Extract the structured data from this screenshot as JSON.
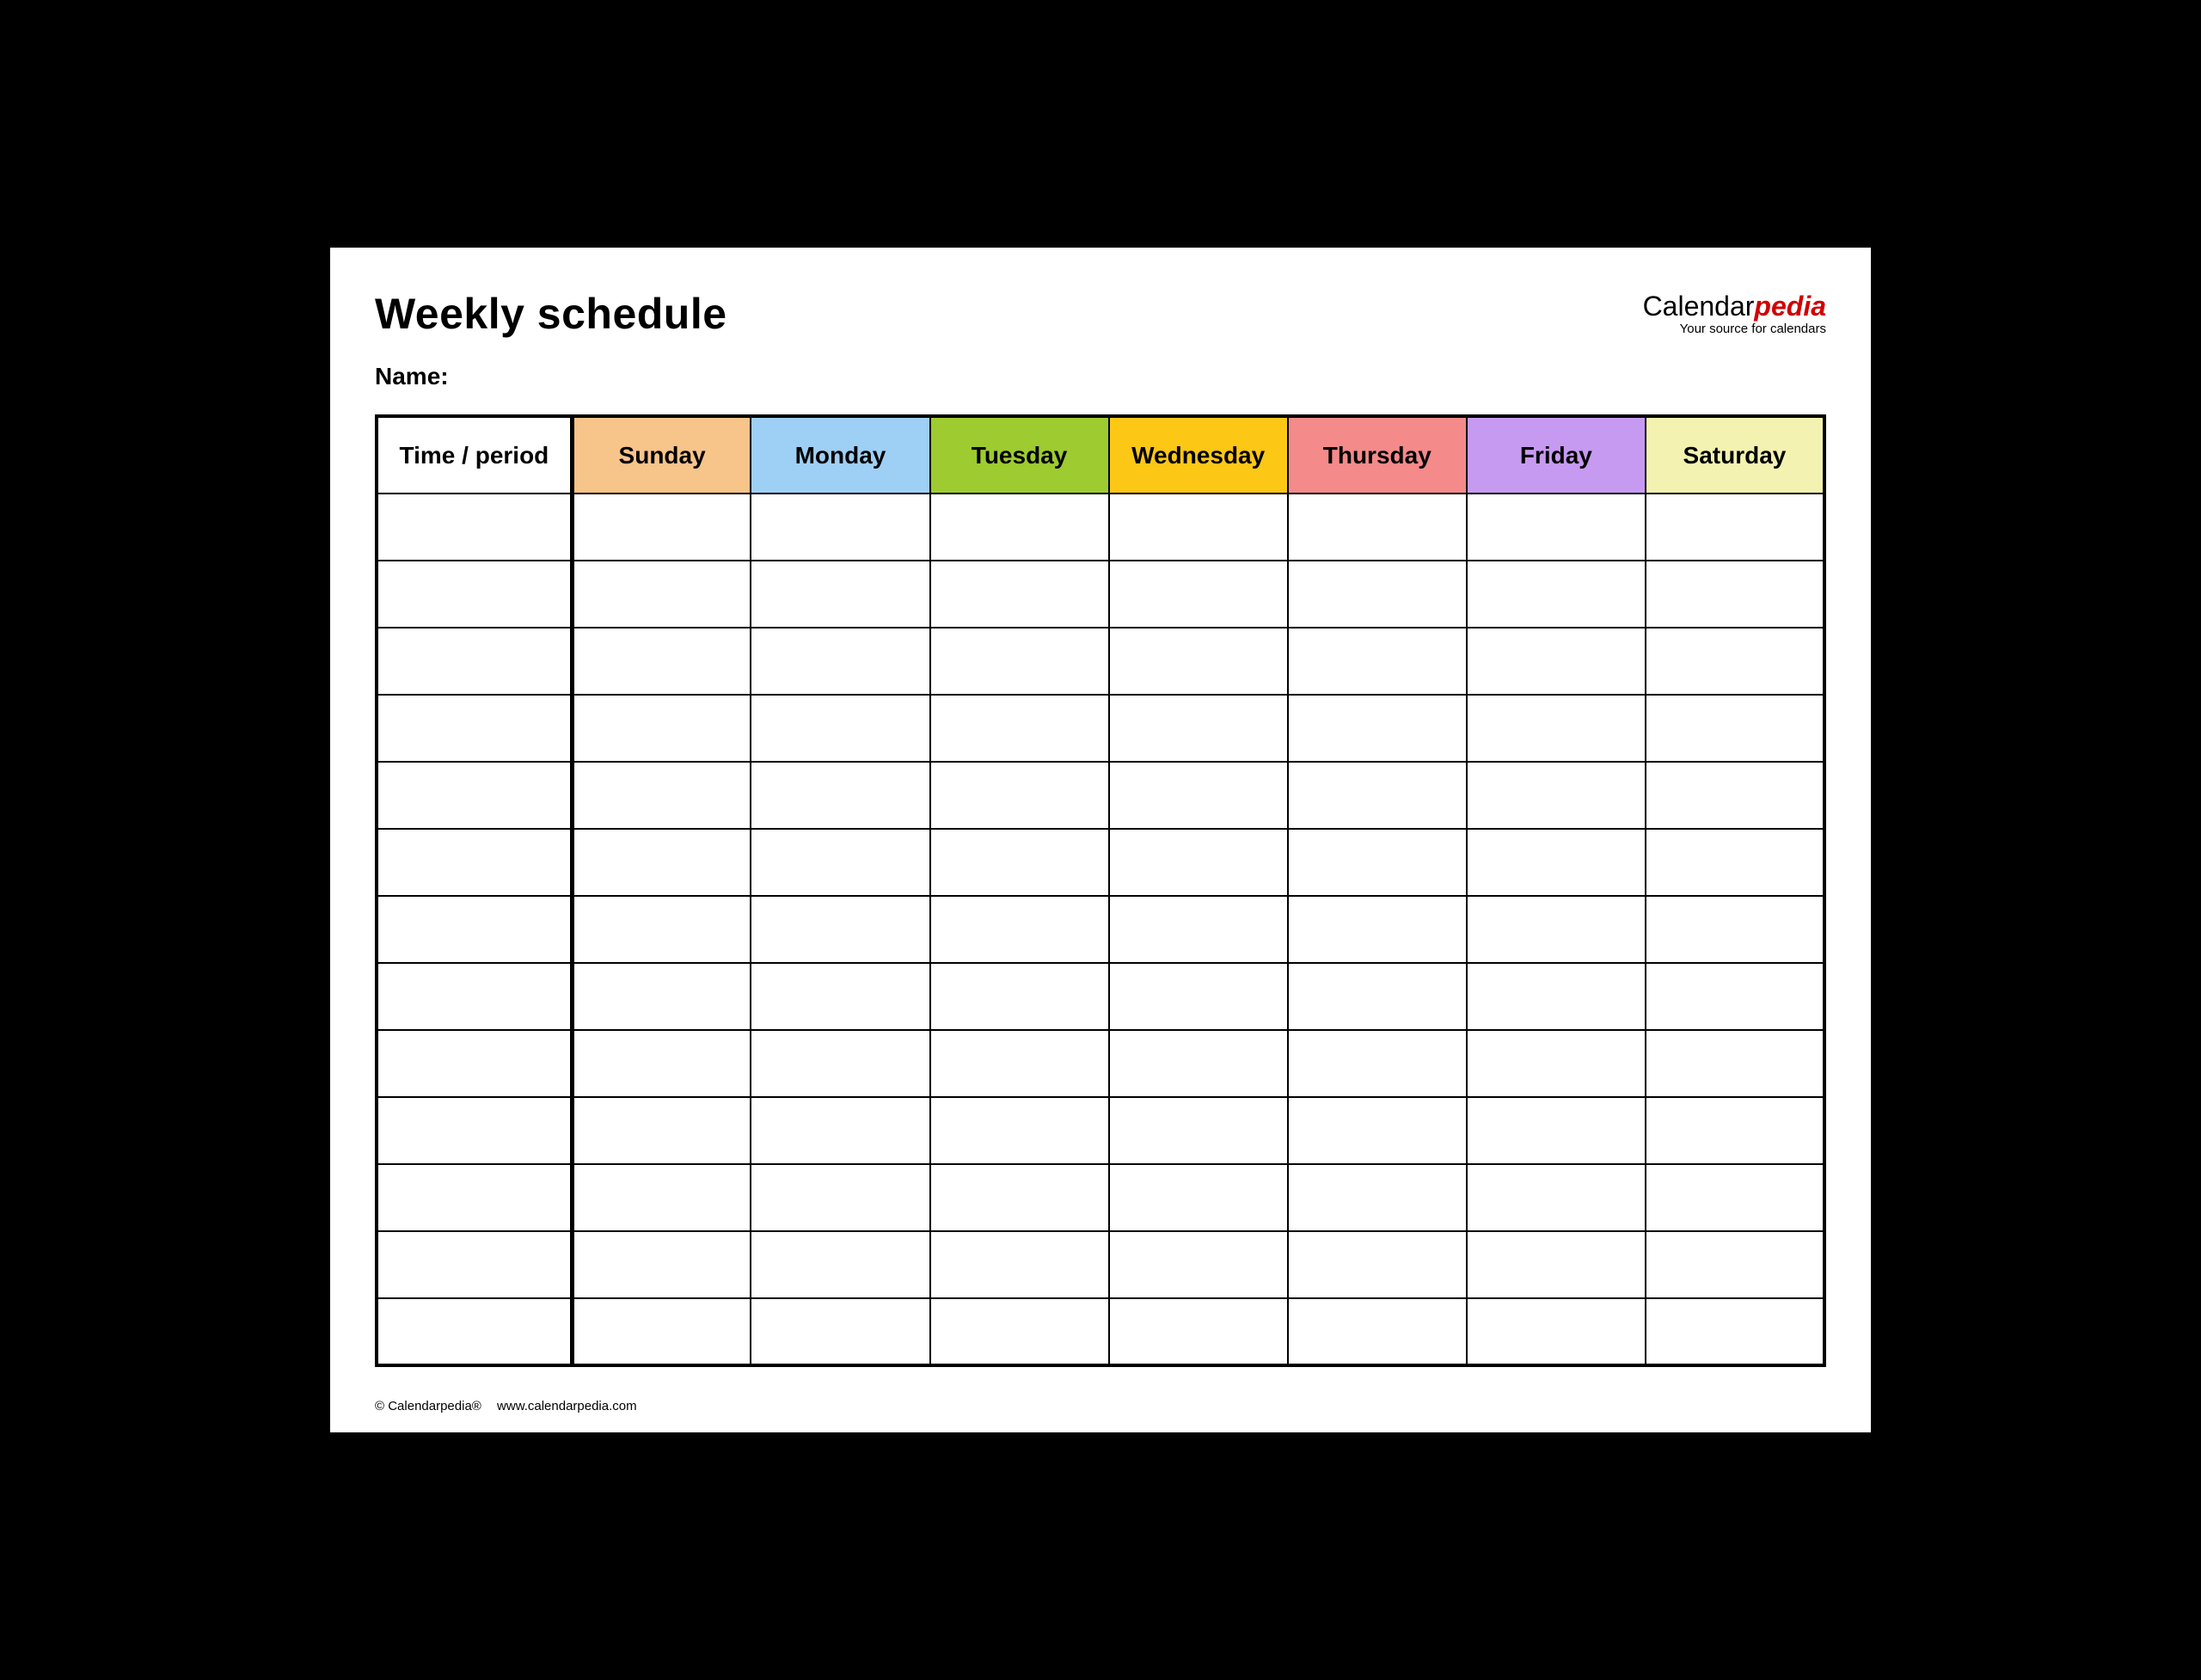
{
  "title": "Weekly schedule",
  "name_label": "Name",
  "brand": {
    "part1": "Calendar",
    "part2": "pedia",
    "tagline": "Your source for calendars"
  },
  "columns": [
    {
      "label": "Time / period",
      "color": "#ffffff"
    },
    {
      "label": "Sunday",
      "color": "#f7c48a"
    },
    {
      "label": "Monday",
      "color": "#9ecff5"
    },
    {
      "label": "Tuesday",
      "color": "#9ecb2f"
    },
    {
      "label": "Wednesday",
      "color": "#fdc716"
    },
    {
      "label": "Thursday",
      "color": "#f48a8a"
    },
    {
      "label": "Friday",
      "color": "#c79af2"
    },
    {
      "label": "Saturday",
      "color": "#f4f2b0"
    }
  ],
  "row_count": 13,
  "footer": {
    "copyright": "© Calendarpedia®",
    "url": "www.calendarpedia.com"
  }
}
